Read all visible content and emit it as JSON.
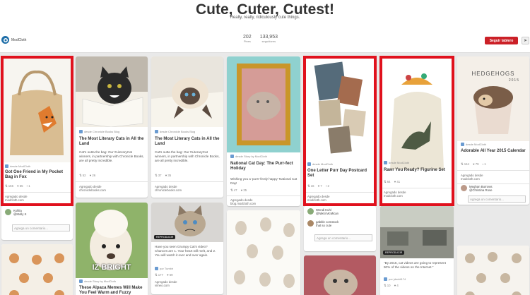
{
  "board": {
    "title": "Cute, Cuter, Cutest!",
    "description": "Really, really, ridiculously cute things.",
    "owner": "ModCloth",
    "pins_count": "202",
    "pins_label": "Pines",
    "followers_count": "133,953",
    "followers_label": "seguidores",
    "follow_label": "Seguir tablero",
    "send_icon": "send-icon"
  },
  "accent": "#cb2027",
  "highlight_color": "#e0111d",
  "comment_placeholder": "Agrega un comentario...",
  "col1": {
    "pin1": {
      "source": "desde ModCloth",
      "title": "Got One Friend in My Pocket Bag in Fox",
      "repins": "156",
      "likes": "55",
      "comments": "1",
      "via_label": "Agregado desde",
      "via_domain": "modcloth.com"
    },
    "commenter": {
      "name": "Kshlia",
      "handle": "@Molly K"
    }
  },
  "col2": {
    "pin1": {
      "source": "desde Chronicle Books Blog",
      "title": "The Most Literary Cats in All the Land",
      "desc": "Cat's outta the bag: Our #LiteraryCat winners, in partnership with Chronicle Books, are all pretty incredible.",
      "repins": "52",
      "likes": "26",
      "via_label": "Agregado desde",
      "via_domain": "chroniclebooks.com"
    },
    "pin2": {
      "source": "desde Story by ModCloth",
      "overlay": "IZ BRIGHT",
      "title": "These Alpaca Memes Will Make You Feel Warm and Fuzzy"
    }
  },
  "col3": {
    "pin1": {
      "source": "desde Chronicle Books Blog",
      "title": "The Most Literary Cats in All the Land",
      "desc": "Cat's outta the bag: Our #LiteraryCat winners, in partnership with Chronicle Books, are all pretty incredible.",
      "repins": "37",
      "likes": "35",
      "via_label": "Agregado desde",
      "via_domain": "chroniclebooks.com"
    },
    "pin2": {
      "badge": "REPRODUCIR",
      "desc": "Have you seen Grumpy Cat's video? Chances are 1. Your heart will melt, and 2. You will watch it over and over again.",
      "source": "por Tumblr",
      "repins": "177",
      "likes": "69",
      "via_label": "Agregado desde",
      "via_domain": "vimeo.com"
    }
  },
  "col4": {
    "pin1": {
      "source": "desde Story by ModCloth",
      "title": "National Cat Day: The Purr-fect Holiday",
      "desc": "Wishing you a 'purrr-fectly happy' National Cat Day!",
      "repins": "47",
      "likes": "35",
      "via_label": "Agregado desde",
      "via_domain": "blog.modcloth.com"
    }
  },
  "col5": {
    "pin1": {
      "source": "desde ModCloth",
      "title": "One Letter Purr Day Postcard Set",
      "repins": "16",
      "likes": "7",
      "comments": "2",
      "via_label": "Agregado desde",
      "via_domain": "modcloth.com"
    },
    "commenter1": {
      "name": "Wendi Kuhl",
      "handle": "@Nikki McMican"
    },
    "commenter2": {
      "name": "gabble comstock",
      "text": "that so cute"
    }
  },
  "col6": {
    "pin1": {
      "source": "desde ModCloth",
      "title": "Rawr You Ready? Figurine Set",
      "repins": "64",
      "likes": "41",
      "via_label": "Agregado desde",
      "via_domain": "modcloth.com"
    },
    "pin2": {
      "badge": "REPRODUCIR",
      "desc": "\"By 2015, cat videos are going to represent 90% of the videos on the Internet.\"",
      "source": "por jdmidt174",
      "repins": "10",
      "likes": "4"
    }
  },
  "col7": {
    "pin1": {
      "hh_title": "HEDGEHOGS",
      "hh_year": "2015",
      "source": "desde ModCloth",
      "title": "Adorable All Year 2015 Calendar",
      "repins": "164",
      "likes": "79",
      "comments": "1",
      "via_label": "Agregado desde",
      "via_domain": "modcloth.com"
    },
    "commenter": {
      "name": "Meghan Burrows",
      "handle": "@Christina Rose"
    }
  }
}
